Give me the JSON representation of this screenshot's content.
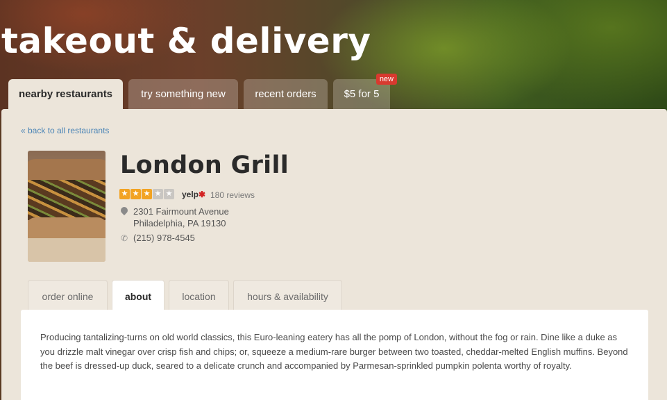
{
  "header": {
    "title": "takeout & delivery"
  },
  "main_tabs": [
    {
      "label": "nearby restaurants",
      "active": true
    },
    {
      "label": "try something new",
      "active": false
    },
    {
      "label": "recent orders",
      "active": false
    },
    {
      "label": "$5 for 5",
      "active": false,
      "badge": "new"
    }
  ],
  "back_link": "« back to all restaurants",
  "restaurant": {
    "name": "London Grill",
    "rating": 3,
    "rating_max": 5,
    "rating_source": "yelp",
    "reviews": "180 reviews",
    "address_line1": "2301 Fairmount Avenue",
    "address_line2": "Philadelphia, PA 19130",
    "phone": "(215) 978-4545"
  },
  "detail_tabs": [
    {
      "label": "order online",
      "active": false
    },
    {
      "label": "about",
      "active": true
    },
    {
      "label": "location",
      "active": false
    },
    {
      "label": "hours & availability",
      "active": false
    }
  ],
  "about_text": "Producing tantalizing-turns on old world classics, this Euro-leaning eatery has all the pomp of London, without the fog or rain. Dine like a duke as you drizzle malt vinegar over crisp fish and chips; or, squeeze a medium-rare burger between two toasted, cheddar-melted English muffins. Beyond the beef is dressed-up duck, seared to a delicate crunch and accompanied by Parmesan-sprinkled pumpkin polenta worthy of royalty.",
  "colors": {
    "badge": "#d83a2f",
    "link": "#4a84b6",
    "star_on": "#f2a323",
    "panel": "#ece5da"
  },
  "icons": {
    "pin": "map-pin-icon",
    "phone": "phone-icon",
    "star": "star-icon",
    "yelp": "yelp-burst-icon"
  }
}
